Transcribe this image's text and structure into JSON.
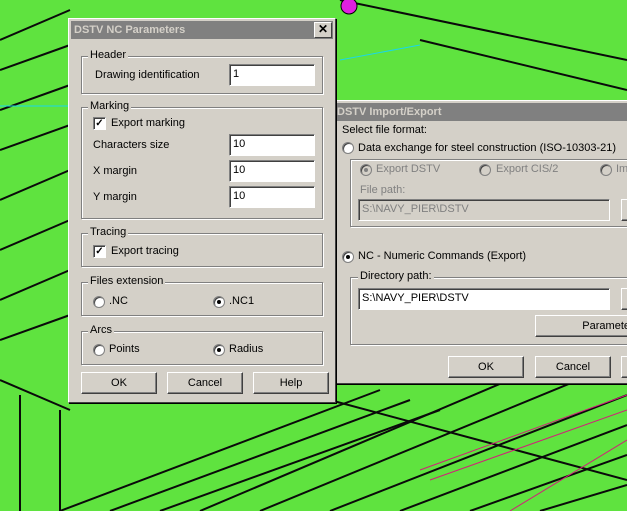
{
  "nc_dialog": {
    "title": "DSTV NC Parameters",
    "close_glyph": "✕",
    "header_group": {
      "label": "Header",
      "drawing_id_label": "Drawing identification",
      "drawing_id_value": "1"
    },
    "marking_group": {
      "label": "Marking",
      "export_marking_label": "Export marking",
      "export_marking_checked": true,
      "chars_size_label": "Characters size",
      "chars_size_value": "10",
      "x_margin_label": "X margin",
      "x_margin_value": "10",
      "y_margin_label": "Y margin",
      "y_margin_value": "10"
    },
    "tracing_group": {
      "label": "Tracing",
      "export_tracing_label": "Export tracing",
      "export_tracing_checked": true
    },
    "files_ext_group": {
      "label": "Files extension",
      "option_nc": ".NC",
      "option_nc1": ".NC1",
      "selected": ".NC1"
    },
    "arcs_group": {
      "label": "Arcs",
      "option_points": "Points",
      "option_radius": "Radius",
      "selected": "Radius"
    },
    "buttons": {
      "ok": "OK",
      "cancel": "Cancel",
      "help": "Help"
    }
  },
  "import_dialog": {
    "title": "DSTV Import/Export",
    "select_format_label": "Select file format:",
    "data_exchange_label": "Data exchange for steel construction (ISO-10303-21)",
    "export_dstv_label": "Export DSTV",
    "export_cis2_label": "Export CIS/2",
    "im_label": "Im",
    "file_path_label": "File path:",
    "file_path_value": "S:\\NAVY_PIER\\DSTV",
    "nc_label": "NC - Numeric Commands (Export)",
    "directory_path_label": "Directory path:",
    "directory_path_value": "S:\\NAVY_PIER\\DSTV",
    "params_button": "Paramete",
    "ok_button": "OK",
    "cancel_button": "Cancel"
  },
  "colors": {
    "background": "#5fe33f",
    "dialog_face": "#d4d0c8",
    "inactive_title": "#808080"
  }
}
